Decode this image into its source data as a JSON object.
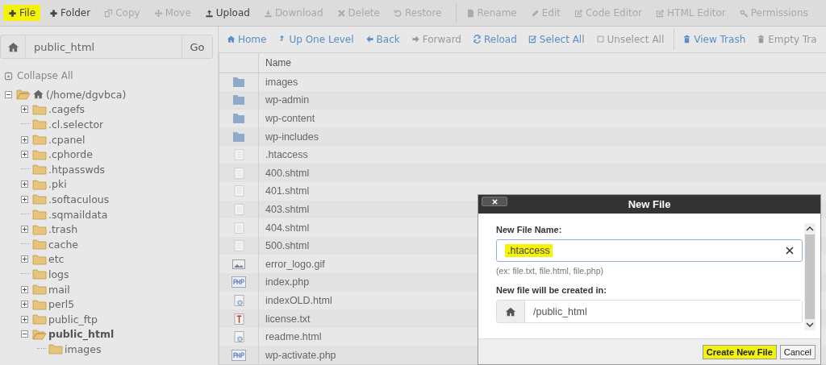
{
  "toolbar": [
    {
      "label": "File",
      "disabled": false,
      "highlighted": true
    },
    {
      "label": "Folder",
      "disabled": false,
      "highlighted": false
    },
    {
      "label": "Copy",
      "disabled": true,
      "highlighted": false
    },
    {
      "label": "Move",
      "disabled": true,
      "highlighted": false
    },
    {
      "label": "Upload",
      "disabled": false,
      "highlighted": false
    },
    {
      "label": "Download",
      "disabled": true,
      "highlighted": false
    },
    {
      "label": "Delete",
      "disabled": true,
      "highlighted": false
    },
    {
      "label": "Restore",
      "disabled": true,
      "highlighted": false
    },
    {
      "label": "Rename",
      "disabled": true,
      "highlighted": false
    },
    {
      "label": "Edit",
      "disabled": true,
      "highlighted": false
    },
    {
      "label": "Code Editor",
      "disabled": true,
      "highlighted": false
    },
    {
      "label": "HTML Editor",
      "disabled": true,
      "highlighted": false
    },
    {
      "label": "Permissions",
      "disabled": true,
      "highlighted": false
    }
  ],
  "path_bar": {
    "value": "public_html",
    "go": "Go"
  },
  "nav": [
    {
      "label": "Home",
      "disabled": false
    },
    {
      "label": "Up One Level",
      "disabled": false
    },
    {
      "label": "Back",
      "disabled": false
    },
    {
      "label": "Forward",
      "disabled": true
    },
    {
      "label": "Reload",
      "disabled": false
    },
    {
      "label": "Select All",
      "disabled": false
    },
    {
      "label": "Unselect All",
      "disabled": true
    },
    {
      "label": "View Trash",
      "disabled": false
    },
    {
      "label": "Empty Tra",
      "disabled": true
    }
  ],
  "sidebar": {
    "collapse_all": "Collapse All",
    "tree": [
      {
        "label": "(/home/dgvbca)",
        "expandable": true,
        "expanded": true,
        "selected": false,
        "children": [
          {
            "label": ".cagefs",
            "expandable": true,
            "expanded": false,
            "selected": false
          },
          {
            "label": ".cl.selector",
            "expandable": false,
            "expanded": false,
            "selected": false
          },
          {
            "label": ".cpanel",
            "expandable": true,
            "expanded": false,
            "selected": false
          },
          {
            "label": ".cphorde",
            "expandable": true,
            "expanded": false,
            "selected": false
          },
          {
            "label": ".htpasswds",
            "expandable": false,
            "expanded": false,
            "selected": false
          },
          {
            "label": ".pki",
            "expandable": true,
            "expanded": false,
            "selected": false
          },
          {
            "label": ".softaculous",
            "expandable": true,
            "expanded": false,
            "selected": false
          },
          {
            "label": ".sqmaildata",
            "expandable": false,
            "expanded": false,
            "selected": false
          },
          {
            "label": ".trash",
            "expandable": true,
            "expanded": false,
            "selected": false
          },
          {
            "label": "cache",
            "expandable": false,
            "expanded": false,
            "selected": false
          },
          {
            "label": "etc",
            "expandable": true,
            "expanded": false,
            "selected": false
          },
          {
            "label": "logs",
            "expandable": false,
            "expanded": false,
            "selected": false
          },
          {
            "label": "mail",
            "expandable": true,
            "expanded": false,
            "selected": false
          },
          {
            "label": "perl5",
            "expandable": true,
            "expanded": false,
            "selected": false
          },
          {
            "label": "public_ftp",
            "expandable": true,
            "expanded": false,
            "selected": false
          },
          {
            "label": "public_html",
            "expandable": true,
            "expanded": true,
            "selected": true,
            "children": [
              {
                "label": "images",
                "expandable": false,
                "expanded": false,
                "selected": false
              }
            ]
          }
        ]
      }
    ]
  },
  "table": {
    "columns": [
      "Name"
    ],
    "rows": [
      {
        "name": "images",
        "kind": "folder"
      },
      {
        "name": "wp-admin",
        "kind": "folder"
      },
      {
        "name": "wp-content",
        "kind": "folder"
      },
      {
        "name": "wp-includes",
        "kind": "folder"
      },
      {
        "name": ".htaccess",
        "kind": "file"
      },
      {
        "name": "400.shtml",
        "kind": "file"
      },
      {
        "name": "401.shtml",
        "kind": "file"
      },
      {
        "name": "403.shtml",
        "kind": "file"
      },
      {
        "name": "404.shtml",
        "kind": "file"
      },
      {
        "name": "500.shtml",
        "kind": "file"
      },
      {
        "name": "error_logo.gif",
        "kind": "image"
      },
      {
        "name": "index.php",
        "kind": "php"
      },
      {
        "name": "indexOLD.html",
        "kind": "html"
      },
      {
        "name": "license.txt",
        "kind": "text"
      },
      {
        "name": "readme.html",
        "kind": "html"
      },
      {
        "name": "wp-activate.php",
        "kind": "php"
      }
    ]
  },
  "dialog": {
    "title": "New File",
    "name_label": "New File Name:",
    "name_value": ".htaccess",
    "name_highlighted": true,
    "hint": "(ex: file.txt, file.html, file.php)",
    "location_label": "New file will be created in:",
    "location_value": "/public_html",
    "buttons": [
      {
        "label": "Create New File",
        "highlighted": true
      },
      {
        "label": "Cancel",
        "highlighted": false
      }
    ]
  }
}
